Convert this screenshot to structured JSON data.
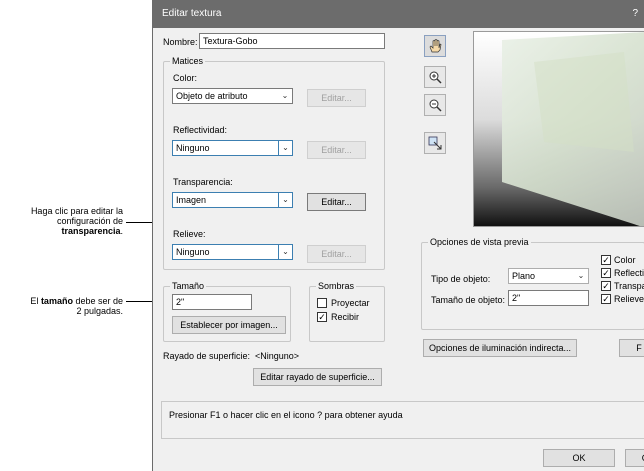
{
  "callouts": {
    "transparency_line1": "Haga clic para editar la",
    "transparency_line2": "configuración de",
    "transparency_line3": "transparencia",
    "transparency_dot": ".",
    "size_pre": "El ",
    "size_bold": "tamaño",
    "size_post": " debe ser de",
    "size_line2": "2 pulgadas."
  },
  "dialog": {
    "title": "Editar textura",
    "help_glyph": "?"
  },
  "name": {
    "label": "Nombre:",
    "value": "Textura-Gobo"
  },
  "shaders": {
    "group_title": "Matices",
    "color": {
      "label": "Color:",
      "value": "Objeto de atributo",
      "edit": "Editar..."
    },
    "reflectivity": {
      "label": "Reflectividad:",
      "value": "Ninguno",
      "edit": "Editar..."
    },
    "transparency": {
      "label": "Transparencia:",
      "value": "Imagen",
      "edit": "Editar..."
    },
    "bump": {
      "label": "Relieve:",
      "value": "Ninguno",
      "edit": "Editar..."
    }
  },
  "size": {
    "group_title": "Tamaño",
    "value": "2\"",
    "set_by_image": "Establecer por imagen..."
  },
  "shadows": {
    "group_title": "Sombras",
    "cast": {
      "label": "Proyectar",
      "checked": false
    },
    "receive": {
      "label": "Recibir",
      "checked": true
    }
  },
  "hatch": {
    "label": "Rayado de superficie:",
    "value": "<Ninguno>",
    "edit": "Editar rayado de superficie..."
  },
  "tools": [
    "hand-icon",
    "zoom-in-icon",
    "zoom-out-icon",
    "fit-view-icon"
  ],
  "preview_options": {
    "group_title": "Opciones de vista previa",
    "object_type": {
      "label": "Tipo de objeto:",
      "value": "Plano"
    },
    "object_size": {
      "label": "Tamaño de objeto:",
      "value": "2\""
    },
    "checks": [
      {
        "label": "Color",
        "checked": true
      },
      {
        "label": "Reflectividad",
        "checked": true
      },
      {
        "label": "Transparencia",
        "checked": true
      },
      {
        "label": "Relieve",
        "checked": true
      }
    ]
  },
  "indirect_lighting_button": "Opciones de iluminación indirecta...",
  "truncated_button": "F",
  "help_text": "Presionar F1 o hacer clic en el icono ? para obtener ayuda",
  "footer": {
    "ok": "OK",
    "cancel": "C"
  }
}
